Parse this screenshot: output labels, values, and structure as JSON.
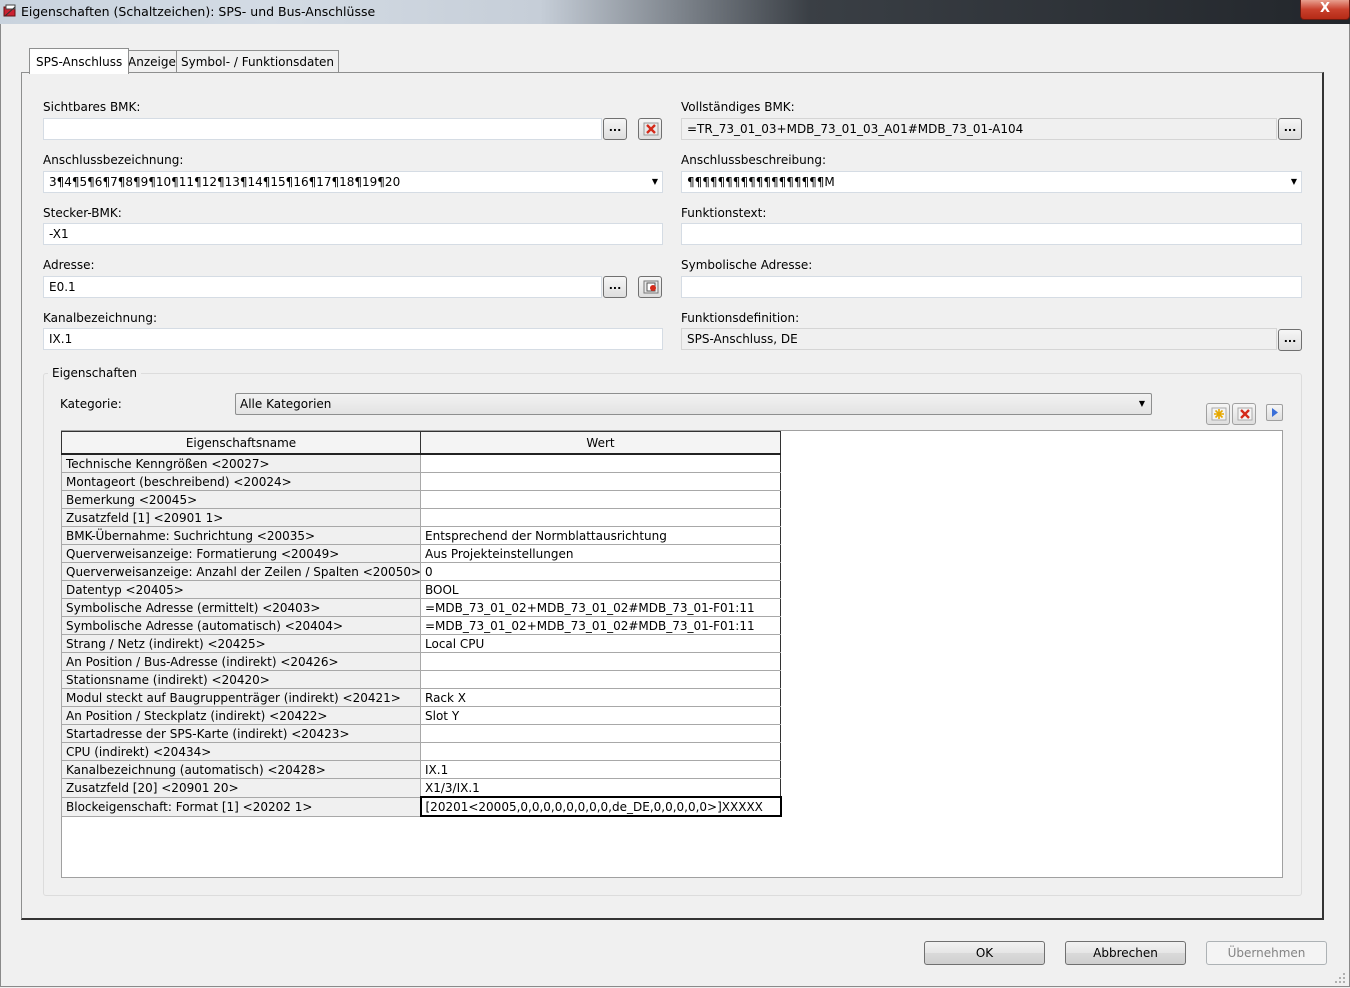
{
  "window": {
    "title": "Eigenschaften (Schaltzeichen): SPS- und Bus-Anschlüsse",
    "close_label": "X"
  },
  "tabs": [
    {
      "label": "SPS-Anschluss",
      "active": true
    },
    {
      "label": "Anzeige",
      "active": false
    },
    {
      "label": "Symbol- / Funktionsdaten",
      "active": false
    }
  ],
  "form": {
    "sichtbares_bmk": {
      "label": "Sichtbares BMK:",
      "value": ""
    },
    "vollstaendiges_bmk": {
      "label": "Vollständiges BMK:",
      "value": "=TR_73_01_03+MDB_73_01_03_A01#MDB_73_01-A104"
    },
    "anschlussbezeichnung": {
      "label": "Anschlussbezeichnung:",
      "value": "3¶4¶5¶6¶7¶8¶9¶10¶11¶12¶13¶14¶15¶16¶17¶18¶19¶20"
    },
    "anschlussbeschreibung": {
      "label": "Anschlussbeschreibung:",
      "value": "¶¶¶¶¶¶¶¶¶¶¶¶¶¶¶¶¶¶M"
    },
    "stecker_bmk": {
      "label": "Stecker-BMK:",
      "value": "-X1"
    },
    "funktionstext": {
      "label": "Funktionstext:",
      "value": ""
    },
    "adresse": {
      "label": "Adresse:",
      "value": "E0.1"
    },
    "symbolische_adresse": {
      "label": "Symbolische Adresse:",
      "value": ""
    },
    "kanalbezeichnung": {
      "label": "Kanalbezeichnung:",
      "value": "IX.1"
    },
    "funktionsdefinition": {
      "label": "Funktionsdefinition:",
      "value": "SPS-Anschluss, DE"
    },
    "dots_label": "..."
  },
  "properties": {
    "group_title": "Eigenschaften",
    "category_label": "Kategorie:",
    "category_value": "Alle Kategorien",
    "columns": [
      "Eigenschaftsname",
      "Wert"
    ],
    "rows": [
      {
        "name": "Technische Kenngrößen <20027>",
        "value": ""
      },
      {
        "name": "Montageort (beschreibend) <20024>",
        "value": ""
      },
      {
        "name": "Bemerkung <20045>",
        "value": ""
      },
      {
        "name": "Zusatzfeld [1] <20901 1>",
        "value": ""
      },
      {
        "name": "BMK-Übernahme: Suchrichtung <20035>",
        "value": "Entsprechend der Normblattausrichtung"
      },
      {
        "name": "Querverweisanzeige: Formatierung <20049>",
        "value": "Aus Projekteinstellungen"
      },
      {
        "name": "Querverweisanzeige: Anzahl der Zeilen / Spalten <20050>",
        "value": "0"
      },
      {
        "name": "Datentyp <20405>",
        "value": "BOOL"
      },
      {
        "name": "Symbolische Adresse (ermittelt) <20403>",
        "value": "=MDB_73_01_02+MDB_73_01_02#MDB_73_01-F01:11"
      },
      {
        "name": "Symbolische Adresse (automatisch) <20404>",
        "value": "=MDB_73_01_02+MDB_73_01_02#MDB_73_01-F01:11"
      },
      {
        "name": "Strang / Netz (indirekt) <20425>",
        "value": "Local CPU"
      },
      {
        "name": "An Position / Bus-Adresse (indirekt) <20426>",
        "value": ""
      },
      {
        "name": "Stationsname (indirekt) <20420>",
        "value": ""
      },
      {
        "name": "Modul steckt auf Baugruppenträger (indirekt) <20421>",
        "value": "Rack X"
      },
      {
        "name": "An Position / Steckplatz (indirekt) <20422>",
        "value": "Slot Y"
      },
      {
        "name": "Startadresse der SPS-Karte (indirekt) <20423>",
        "value": ""
      },
      {
        "name": "CPU (indirekt) <20434>",
        "value": ""
      },
      {
        "name": "Kanalbezeichnung (automatisch) <20428>",
        "value": "IX.1"
      },
      {
        "name": "Zusatzfeld [20] <20901 20>",
        "value": "X1/3/IX.1"
      },
      {
        "name": "Blockeigenschaft: Format [1] <20202 1>",
        "value": "[20201<20005,0,0,0,0,0,0,0,0,de_DE,0,0,0,0,0>]XXXXX"
      }
    ],
    "selected_row_index": 19
  },
  "dialog_buttons": {
    "ok": "OK",
    "cancel": "Abbrechen",
    "apply": "Übernehmen"
  }
}
